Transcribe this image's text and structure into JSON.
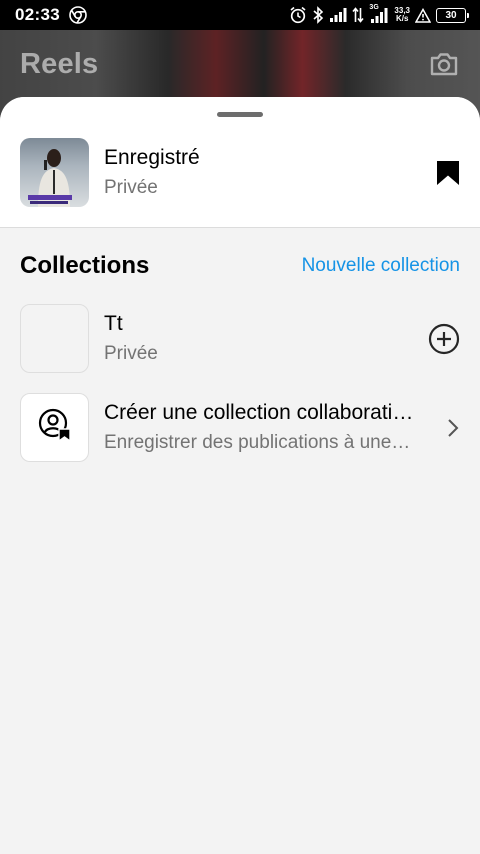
{
  "status_bar": {
    "time": "02:33",
    "network_type": "3G",
    "net_speed_value": "33,3",
    "net_speed_unit": "K/s",
    "battery_level": "30"
  },
  "background": {
    "title": "Reels"
  },
  "sheet": {
    "saved": {
      "title": "Enregistré",
      "privacy": "Privée"
    },
    "collections_title": "Collections",
    "new_collection_label": "Nouvelle collection",
    "collections": [
      {
        "name": "Tt",
        "privacy": "Privée"
      }
    ],
    "collab": {
      "title": "Créer une collection collaborative",
      "subtitle": "Enregistrer des publications à une collection partagée"
    }
  },
  "icons": {
    "status": [
      "chrome-icon",
      "alarm-icon",
      "bluetooth-icon",
      "signal-icon",
      "data-arrows-icon",
      "signal-3g-icon",
      "warning-icon",
      "battery-icon"
    ],
    "reels": "camera-icon",
    "saved": "bookmark-icon",
    "collection": "add-circle-icon",
    "collab": "user-bookmark-icon",
    "collab_action": "chevron-right-icon"
  },
  "colors": {
    "accent": "#1593e6",
    "secondary_text": "#737373",
    "sheet_bg": "#f3f3f3"
  }
}
